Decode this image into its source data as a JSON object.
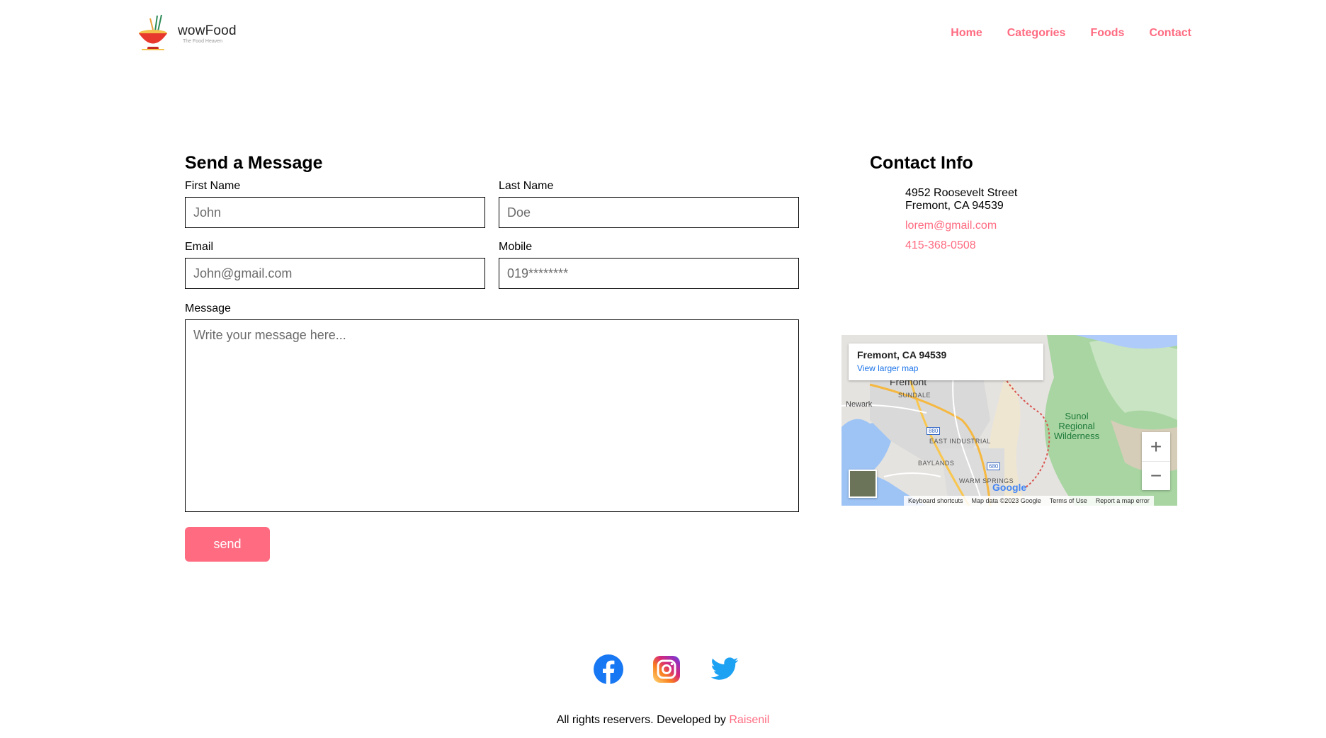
{
  "brand": {
    "name": "wowFood",
    "tagline": "The Food Heaven"
  },
  "nav": {
    "items": [
      "Home",
      "Categories",
      "Foods",
      "Contact"
    ]
  },
  "form": {
    "title": "Send a Message",
    "first_name": {
      "label": "First Name",
      "placeholder": "John"
    },
    "last_name": {
      "label": "Last Name",
      "placeholder": "Doe"
    },
    "email": {
      "label": "Email",
      "placeholder": "John@gmail.com"
    },
    "mobile": {
      "label": "Mobile",
      "placeholder": "019********"
    },
    "message": {
      "label": "Message",
      "placeholder": "Write your message here..."
    },
    "send_label": "send"
  },
  "contact": {
    "title": "Contact Info",
    "address_line1": "4952 Roosevelt Street",
    "address_line2": "Fremont, CA 94539",
    "email": "lorem@gmail.com",
    "phone": "415-368-0508"
  },
  "map": {
    "place": "Fremont, CA 94539",
    "view_larger": "View larger map",
    "labels": {
      "fremont": "Fremont",
      "sundale": "SUNDALE",
      "newark": "Newark",
      "east_industrial": "EAST INDUSTRIAL",
      "baylands": "BAYLANDS",
      "warm_springs": "WARM SPRINGS",
      "sunol": "Sunol Regional Wilderness",
      "hwy880": "880",
      "hwy680": "680",
      "google": "Google"
    },
    "footer": {
      "keyboard": "Keyboard shortcuts",
      "data": "Map data ©2023 Google",
      "terms": "Terms of Use",
      "report": "Report a map error"
    }
  },
  "footer": {
    "text": "All rights reservers. Developed by",
    "developer": "Raisenil",
    "social": [
      "facebook-icon",
      "instagram-icon",
      "twitter-icon"
    ]
  },
  "colors": {
    "accent": "#ff6b81",
    "facebook": "#1877f2",
    "twitter": "#1da1f2"
  }
}
